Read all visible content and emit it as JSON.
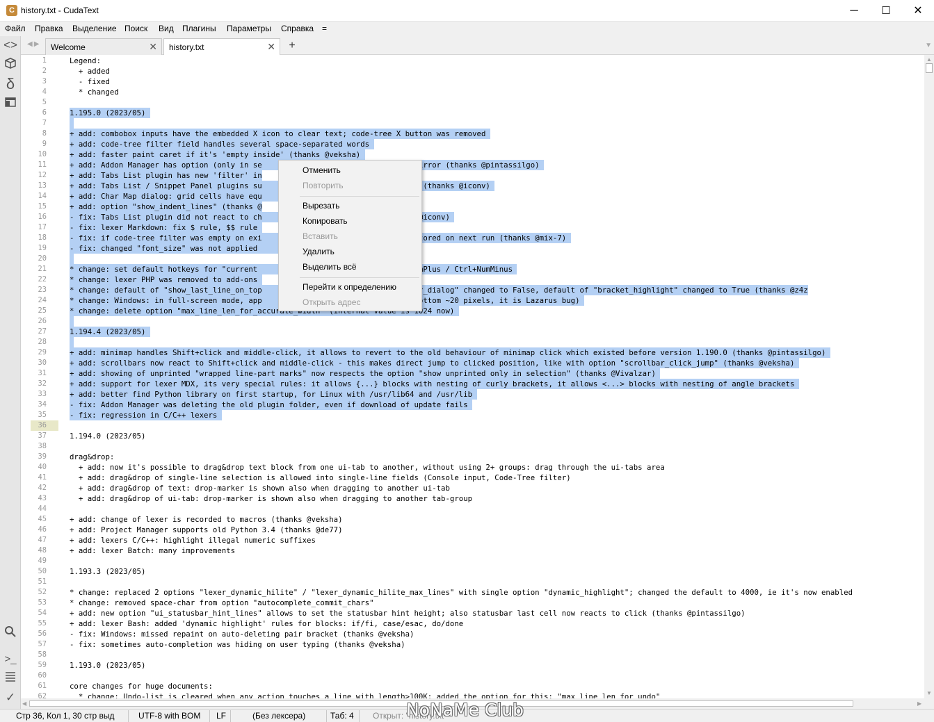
{
  "window": {
    "title": "history.txt - CudaText",
    "app_icon_letter": "C",
    "minimize": "─",
    "maximize": "☐",
    "close": "✕"
  },
  "menubar": [
    "Файл",
    "Правка",
    "Выделение",
    "Поиск",
    "Вид",
    "Плагины",
    "Параметры",
    "Справка",
    "="
  ],
  "sidebar": {
    "icons": [
      "code-tree-icon",
      "project-icon",
      "snippets-icon",
      "tabs-icon",
      "search-icon",
      "console-icon",
      "list-icon",
      "validate-icon"
    ]
  },
  "tabs": [
    {
      "label": "Welcome",
      "close": "✕",
      "active": false
    },
    {
      "label": "history.txt",
      "close": "✕",
      "active": true
    }
  ],
  "tab_plus": "+",
  "editor": {
    "current_line": 36,
    "lines": [
      {
        "n": "1",
        "text": "Legend:",
        "sel": false
      },
      {
        "n": "2",
        "text": "  + added",
        "sel": false
      },
      {
        "n": "3",
        "text": "  - fixed",
        "sel": false
      },
      {
        "n": "4",
        "text": "  * changed",
        "sel": false
      },
      {
        "n": "5",
        "text": "",
        "sel": false
      },
      {
        "n": "6",
        "text": "1.195.0 (2023/05) ",
        "sel": true
      },
      {
        "n": "7",
        "text": " ",
        "sel": true
      },
      {
        "n": "8",
        "text": "+ add: combobox inputs have the embedded X icon to clear text; code-tree X button was removed ",
        "sel": true
      },
      {
        "n": "9",
        "text": "+ add: code-tree filter field handles several space-separated words ",
        "sel": true
      },
      {
        "n": "10",
        "text": "+ add: faster paint caret if it's 'empty inside' (thanks @veksha) ",
        "sel": true
      },
      {
        "n": "11",
        "text": "+ add: Addon Manager has option (only in se                  set SourceForge mirror (thanks @pintassilgo) ",
        "sel": true
      },
      {
        "n": "12",
        "text": "+ add: Tabs List plugin has new 'filter' in",
        "sel": true
      },
      {
        "n": "13",
        "text": "+ add: Tabs List / Snippet Panel plugins su                  Shift+mouse_wheel (thanks @iconv) ",
        "sel": true
      },
      {
        "n": "14",
        "text": "+ add: Char Map dialog: grid cells have equ                  (thanks @iconv) ",
        "sel": true
      },
      {
        "n": "15",
        "text": "+ add: option \"show_indent_lines\" (thanks @",
        "sel": true
      },
      {
        "n": "16",
        "text": "- fix: Tabs List plugin did not react to ch                  odified\" (thanks @iconv) ",
        "sel": true
      },
      {
        "n": "17",
        "text": "- fix: lexer Markdown: fix $ rule, $$ rule ",
        "sel": true
      },
      {
        "n": "18",
        "text": "- fix: if code-tree filter was empty on exi                  lters was not restored on next run (thanks @mix-7) ",
        "sel": true
      },
      {
        "n": "19",
        "text": "- fix: changed \"font_size\" was not applied                   anks @veksha) ",
        "sel": true
      },
      {
        "n": "20",
        "text": " ",
        "sel": true
      },
      {
        "n": "21",
        "text": "* change: set default hotkeys for \"current                   aller\" to Ctrl+NumPlus / Ctrl+NumMinus ",
        "sel": true
      },
      {
        "n": "22",
        "text": "* change: lexer PHP was removed to add-ons ",
        "sel": true
      },
      {
        "n": "23",
        "text": "* change: default of \"show_last_line_on_top                  f \"ui_tab_switcher_dialog\" changed to False, default of \"bracket_highlight\" changed to True (thanks @z4z",
        "sel": true
      },
      {
        "n": "24",
        "text": "* change: Windows: in full-screen mode, app                  (to fix missing bottom ~20 pixels, it is Lazarus bug) ",
        "sel": true
      },
      {
        "n": "25",
        "text": "* change: delete option \"max_line_len_for_accurate_width\" (internal value is 1024 now) ",
        "sel": true
      },
      {
        "n": "26",
        "text": " ",
        "sel": true
      },
      {
        "n": "27",
        "text": "1.194.4 (2023/05) ",
        "sel": true
      },
      {
        "n": "28",
        "text": " ",
        "sel": true
      },
      {
        "n": "29",
        "text": "+ add: minimap handles Shift+click and middle-click, it allows to revert to the old behaviour of minimap click which existed before version 1.190.0 (thanks @pintassilgo) ",
        "sel": true
      },
      {
        "n": "30",
        "text": "+ add: scrollbars now react to Shift+click and middle-click - this makes direct jump to clicked position, like with option \"scrollbar_click_jump\" (thanks @veksha) ",
        "sel": true
      },
      {
        "n": "31",
        "text": "+ add: showing of unprinted \"wrapped line-part marks\" now respects the option \"show unprinted only in selection\" (thanks @Vivalzar) ",
        "sel": true
      },
      {
        "n": "32",
        "text": "+ add: support for lexer MDX, its very special rules: it allows {...} blocks with nesting of curly brackets, it allows <...> blocks with nesting of angle brackets ",
        "sel": true
      },
      {
        "n": "33",
        "text": "+ add: better find Python library on first startup, for Linux with /usr/lib64 and /usr/lib ",
        "sel": true
      },
      {
        "n": "34",
        "text": "- fix: Addon Manager was deleting the old plugin folder, even if download of update fails ",
        "sel": true
      },
      {
        "n": "35",
        "text": "- fix: regression in C/C++ lexers ",
        "sel": true
      },
      {
        "n": "36",
        "text": "",
        "sel": false
      },
      {
        "n": "37",
        "text": "1.194.0 (2023/05)",
        "sel": false
      },
      {
        "n": "38",
        "text": "",
        "sel": false
      },
      {
        "n": "39",
        "text": "drag&drop:",
        "sel": false
      },
      {
        "n": "40",
        "text": "  + add: now it's possible to drag&drop text block from one ui-tab to another, without using 2+ groups: drag through the ui-tabs area",
        "sel": false
      },
      {
        "n": "41",
        "text": "  + add: drag&drop of single-line selection is allowed into single-line fields (Console input, Code-Tree filter)",
        "sel": false
      },
      {
        "n": "42",
        "text": "  + add: drag&drop of text: drop-marker is shown also when dragging to another ui-tab",
        "sel": false
      },
      {
        "n": "43",
        "text": "  + add: drag&drop of ui-tab: drop-marker is shown also when dragging to another tab-group",
        "sel": false
      },
      {
        "n": "44",
        "text": "",
        "sel": false
      },
      {
        "n": "45",
        "text": "+ add: change of lexer is recorded to macros (thanks @veksha)",
        "sel": false
      },
      {
        "n": "46",
        "text": "+ add: Project Manager supports old Python 3.4 (thanks @de77)",
        "sel": false
      },
      {
        "n": "47",
        "text": "+ add: lexers C/C++: highlight illegal numeric suffixes",
        "sel": false
      },
      {
        "n": "48",
        "text": "+ add: lexer Batch: many improvements",
        "sel": false
      },
      {
        "n": "49",
        "text": "",
        "sel": false
      },
      {
        "n": "50",
        "text": "1.193.3 (2023/05)",
        "sel": false
      },
      {
        "n": "51",
        "text": "",
        "sel": false
      },
      {
        "n": "52",
        "text": "* change: replaced 2 options \"lexer_dynamic_hilite\" / \"lexer_dynamic_hilite_max_lines\" with single option \"dynamic_highlight\"; changed the default to 4000, ie it's now enabled",
        "sel": false
      },
      {
        "n": "53",
        "text": "* change: removed space-char from option \"autocomplete_commit_chars\"",
        "sel": false
      },
      {
        "n": "54",
        "text": "+ add: new option \"ui_statusbar_hint_lines\" allows to set the statusbar hint height; also statusbar last cell now reacts to click (thanks @pintassilgo)",
        "sel": false
      },
      {
        "n": "55",
        "text": "+ add: lexer Bash: added 'dynamic highlight' rules for blocks: if/fi, case/esac, do/done",
        "sel": false
      },
      {
        "n": "56",
        "text": "- fix: Windows: missed repaint on auto-deleting pair bracket (thanks @veksha)",
        "sel": false
      },
      {
        "n": "57",
        "text": "- fix: sometimes auto-completion was hiding on user typing (thanks @veksha)",
        "sel": false
      },
      {
        "n": "58",
        "text": "",
        "sel": false
      },
      {
        "n": "59",
        "text": "1.193.0 (2023/05)",
        "sel": false
      },
      {
        "n": "60",
        "text": "",
        "sel": false
      },
      {
        "n": "61",
        "text": "core changes for huge documents:",
        "sel": false
      },
      {
        "n": "62",
        "text": "  * change: Undo-list is cleared when any action touches a line with length>100K; added the option for this: \"max_line_len_for_undo\"",
        "sel": false
      }
    ]
  },
  "context_menu": {
    "items": [
      {
        "label": "Отменить",
        "disabled": false
      },
      {
        "label": "Повторить",
        "disabled": true
      },
      {
        "label": "Вырезать",
        "disabled": false
      },
      {
        "label": "Копировать",
        "disabled": false
      },
      {
        "label": "Вставить",
        "disabled": true
      },
      {
        "label": "Удалить",
        "disabled": false
      },
      {
        "label": "Выделить всё",
        "disabled": false
      },
      {
        "label": "Перейти к определению",
        "disabled": false
      },
      {
        "label": "Открыть адрес",
        "disabled": true
      }
    ]
  },
  "statusbar": {
    "position": "Стр 36, Кол 1, 30 стр выд",
    "encoding": "UTF-8 with BOM",
    "line_ending": "LF",
    "lexer": "(Без лексера)",
    "tab": "Таб: 4",
    "hint": "Открыт: \"history.txt\""
  },
  "watermark": "NoNaMe Club"
}
